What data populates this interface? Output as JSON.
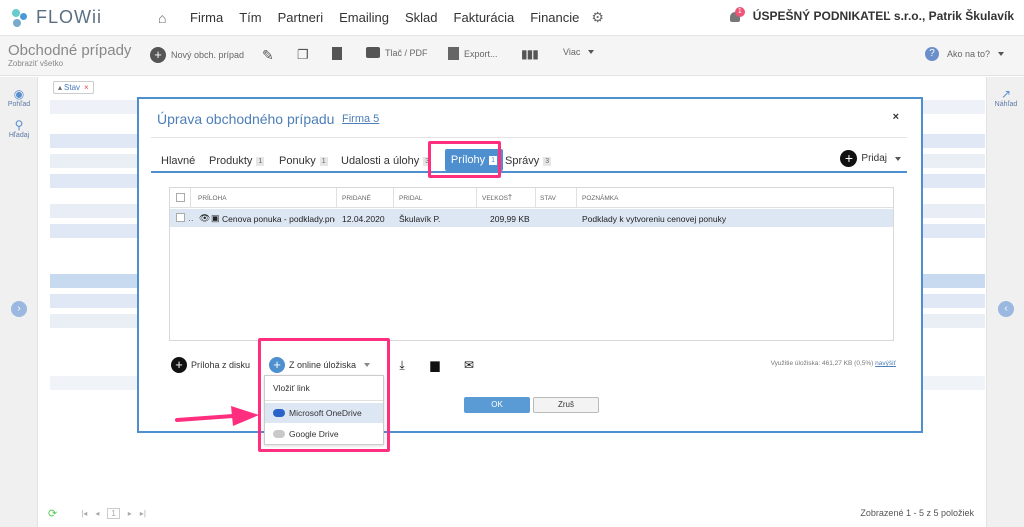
{
  "app": {
    "logo": "FLOWii"
  },
  "nav": {
    "items": [
      "Firma",
      "Tím",
      "Partneri",
      "Emailing",
      "Sklad",
      "Fakturácia",
      "Financie"
    ],
    "notification_count": "1",
    "company": "ÚSPEŠNÝ PODNIKATEĽ s.r.o., Patrik Škulavík"
  },
  "toolbar": {
    "title": "Obchodné prípady",
    "subtitle": "Zobraziť všetko",
    "new_case": "Nový obch. prípad",
    "print": "Tlač / PDF",
    "export": "Export...",
    "more": "Viac",
    "help": "Ako na to?"
  },
  "rails": {
    "view": "Pohľad",
    "search": "Hľadaj",
    "preview": "Náhľad"
  },
  "filter": {
    "chip": "Stav"
  },
  "statusbar": {
    "page": "1",
    "shown": "Zobrazené 1 - 5 z 5 položiek"
  },
  "modal": {
    "title": "Úprava obchodného prípadu",
    "company_link": "Firma 5",
    "tabs": [
      {
        "label": "Hlavné",
        "count": ""
      },
      {
        "label": "Produkty",
        "count": "1"
      },
      {
        "label": "Ponuky",
        "count": "1"
      },
      {
        "label": "Udalosti a úlohy",
        "count": "3"
      },
      {
        "label": "Prílohy",
        "count": "1"
      },
      {
        "label": "Správy",
        "count": "3"
      }
    ],
    "add": "Pridaj",
    "grid": {
      "headers": [
        "PRÍLOHA",
        "PRIDANÉ",
        "PRIDAL",
        "VEĽKOSŤ",
        "STAV",
        "POZNÁMKA"
      ],
      "rows": [
        {
          "file": "Cenova ponuka - podklady.png",
          "added": "12.04.2020",
          "by": "Škulavík P.",
          "size": "209,99 KB",
          "status": "",
          "note": "Podklady k vytvoreniu cenovej ponuky"
        }
      ]
    },
    "from_disk": "Príloha z disku",
    "from_online": "Z online úložiska",
    "storage_text": "Využitie úložiska: 461,27 KB (0,5%)",
    "storage_link": "navýšiť",
    "ok": "OK",
    "cancel": "Zruš"
  },
  "dropdown": {
    "items": [
      "Vložiť link",
      "Microsoft OneDrive",
      "Google Drive"
    ]
  },
  "colors": {
    "accent": "#4d8fcf",
    "highlight": "#ff2e7e",
    "row_selected": "#dde7f4"
  }
}
